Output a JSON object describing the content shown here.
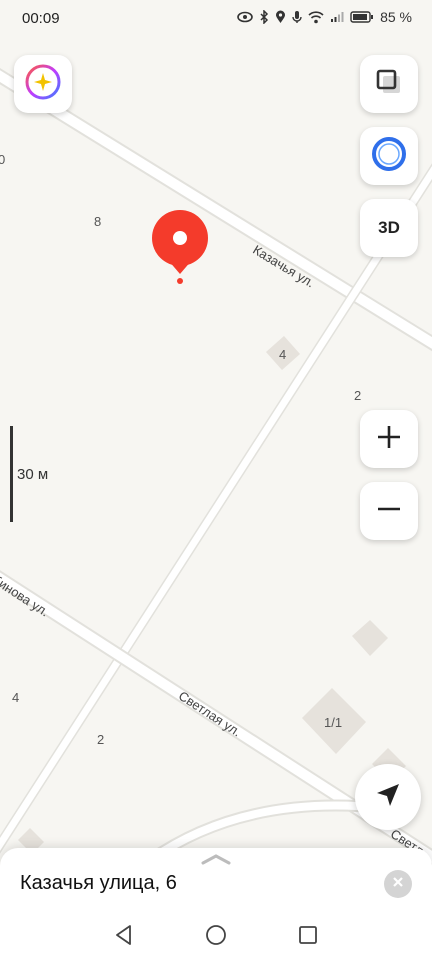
{
  "status_bar": {
    "time": "00:09",
    "battery": "85 %",
    "icons": [
      "eye-icon",
      "bluetooth-icon",
      "location-icon",
      "mic-icon",
      "wifi-icon",
      "signal-icon",
      "battery-icon"
    ]
  },
  "map": {
    "streets": [
      {
        "label": "Казачья ул."
      },
      {
        "label": "бинова ул."
      },
      {
        "label": "Светлая ул."
      },
      {
        "label": "Светл"
      }
    ],
    "house_numbers": [
      "8",
      "4",
      "2",
      "4",
      "2",
      "1/1",
      "0"
    ],
    "scale_label": "30 м",
    "marker_color": "#f43b2b"
  },
  "controls": {
    "layers_icon": "layers-icon",
    "alice_icon": "alice-icon",
    "three_d_label": "3D",
    "zoom_in_icon": "plus-icon",
    "zoom_out_icon": "minus-icon",
    "locate_icon": "navigation-arrow-icon",
    "ai_icon": "sparkle-icon"
  },
  "sheet": {
    "title": "Казачья улица, 6"
  },
  "navigation": [
    "back-icon",
    "home-icon",
    "recents-icon"
  ]
}
